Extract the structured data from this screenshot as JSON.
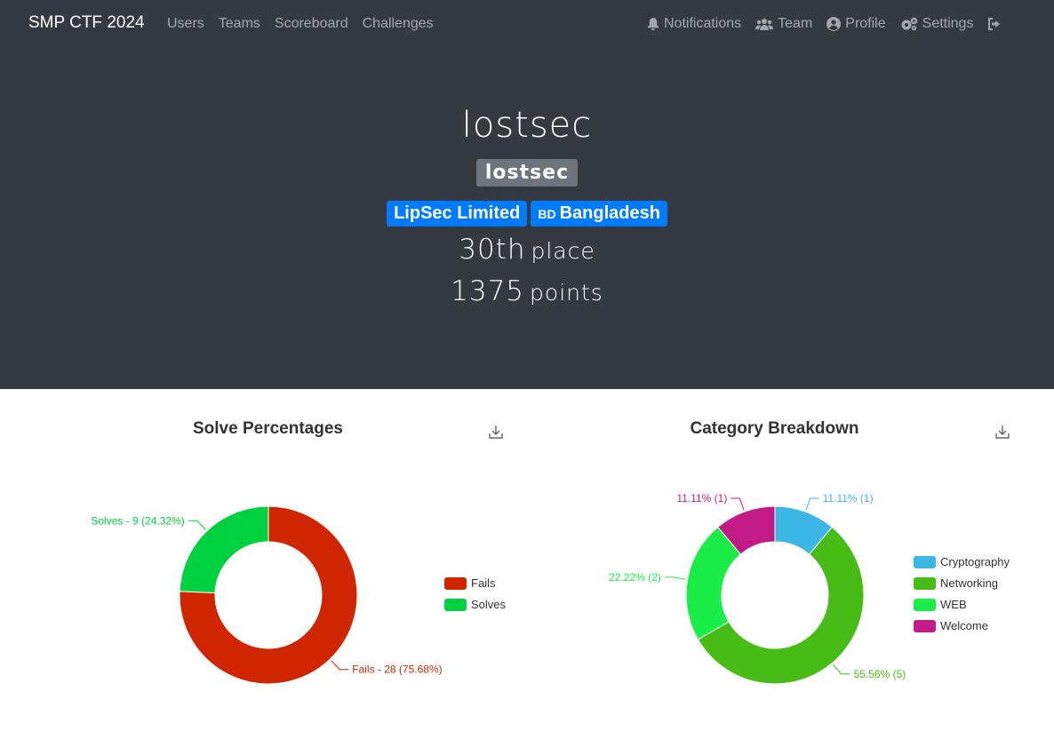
{
  "navbar": {
    "brand": "SMP CTF 2024",
    "left_links": [
      "Users",
      "Teams",
      "Scoreboard",
      "Challenges"
    ],
    "right_links": [
      {
        "label": "Notifications",
        "icon": "bell-icon"
      },
      {
        "label": "Team",
        "icon": "users-icon"
      },
      {
        "label": "Profile",
        "icon": "user-circle-icon"
      },
      {
        "label": "Settings",
        "icon": "gears-icon"
      }
    ],
    "logout_icon": "sign-out-icon"
  },
  "profile": {
    "name": "lostsec",
    "team_badge": "lostsec",
    "affiliation": "LipSec Limited",
    "country_code": "BD",
    "country": "Bangladesh",
    "place": "30th",
    "place_suffix": "place",
    "points": "1375",
    "points_suffix": "points"
  },
  "chart_data": [
    {
      "type": "pie",
      "title": "Solve Percentages",
      "categories": [
        "Fails",
        "Solves"
      ],
      "values": [
        28,
        9
      ],
      "colors": [
        "#cf2600",
        "#00d140"
      ],
      "data_labels": [
        "Fails - 28 (75.68%)",
        "Solves - 9 (24.32%)"
      ],
      "legend": "right",
      "donut": true
    },
    {
      "type": "pie",
      "title": "Category Breakdown",
      "categories": [
        "Cryptography",
        "Networking",
        "WEB",
        "Welcome"
      ],
      "values": [
        1,
        5,
        2,
        1
      ],
      "colors": [
        "#3bb6e5",
        "#48bc16",
        "#1aed48",
        "#c21a86"
      ],
      "data_labels": [
        "11.11% (1)",
        "55.56% (5)",
        "22.22% (2)",
        "11.11% (1)"
      ],
      "legend": "right",
      "donut": true
    }
  ]
}
